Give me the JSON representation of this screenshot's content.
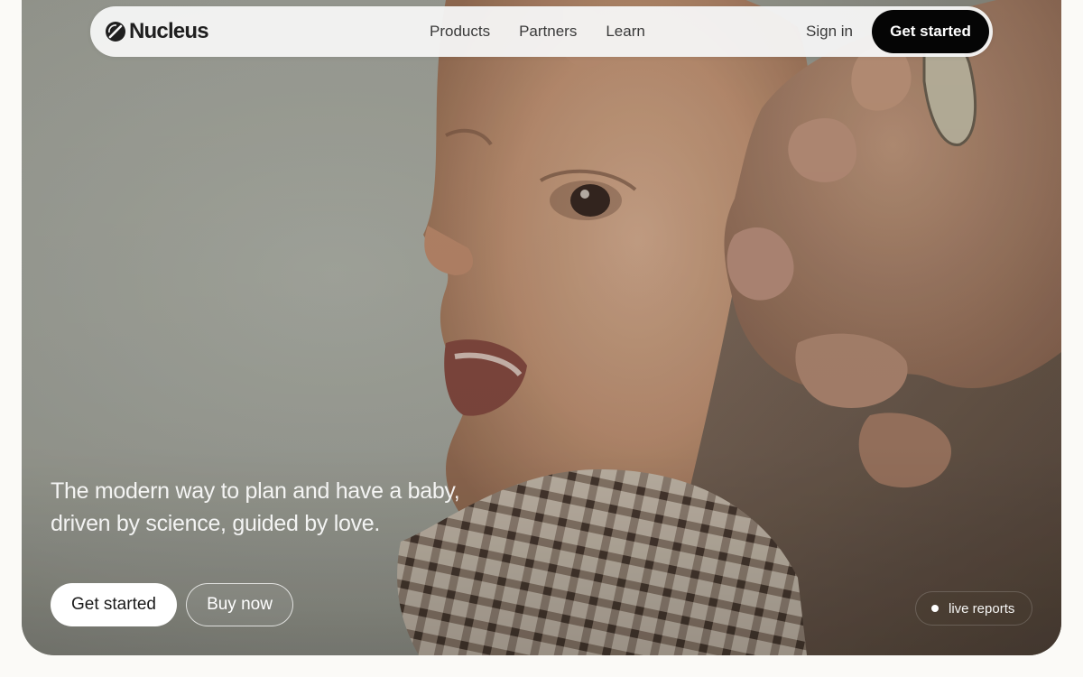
{
  "brand": {
    "name": "Nucleus",
    "icon": "nucleus-logo-icon"
  },
  "nav": {
    "links": [
      "Products",
      "Partners",
      "Learn"
    ],
    "sign_in": "Sign in",
    "cta": "Get started"
  },
  "hero": {
    "tagline_line1": "The modern way to plan and have a baby,",
    "tagline_line2": "driven by science, guided by love.",
    "primary_button": "Get started",
    "secondary_button": "Buy now",
    "badge": "live reports"
  },
  "colors": {
    "page_background": "#fbfaf7",
    "nav_background": "#f6f6f6",
    "cta_background": "#050505",
    "cta_text": "#ffffff"
  }
}
